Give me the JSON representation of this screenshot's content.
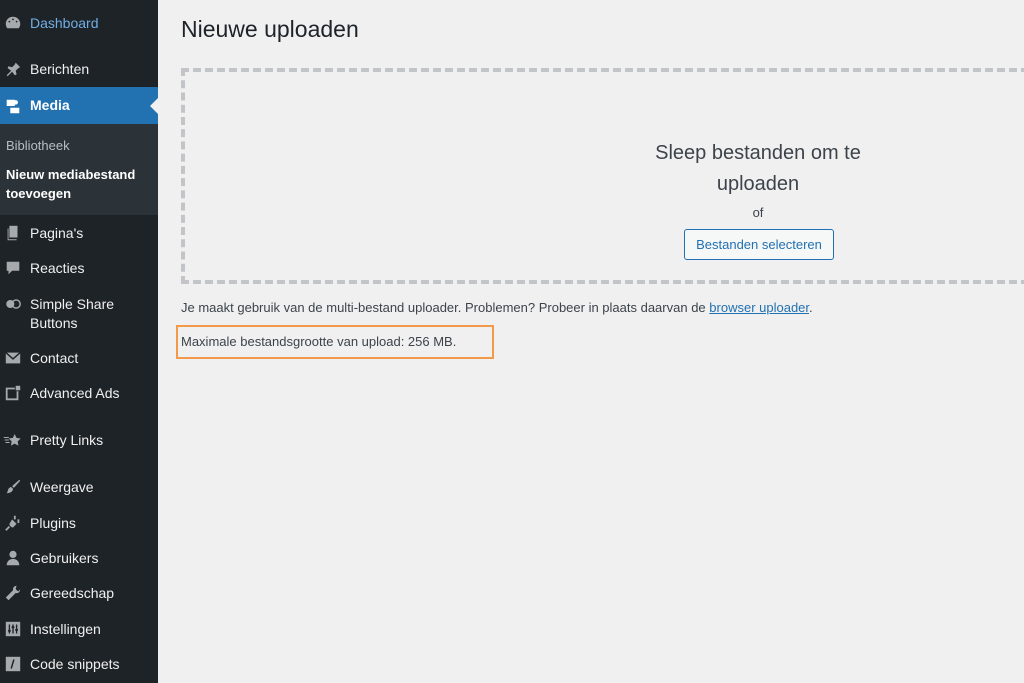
{
  "sidebar": {
    "items": [
      {
        "label": "Dashboard",
        "icon": "dashboard-icon"
      },
      {
        "label": "Berichten",
        "icon": "pin-icon"
      },
      {
        "label": "Media",
        "icon": "media-icon"
      },
      {
        "label": "Pagina's",
        "icon": "pages-icon"
      },
      {
        "label": "Reacties",
        "icon": "comment-icon"
      },
      {
        "label": "Simple Share Buttons",
        "icon": "share-icon"
      },
      {
        "label": "Contact",
        "icon": "mail-icon"
      },
      {
        "label": "Advanced Ads",
        "icon": "ads-icon"
      },
      {
        "label": "Pretty Links",
        "icon": "star-icon"
      },
      {
        "label": "Weergave",
        "icon": "brush-icon"
      },
      {
        "label": "Plugins",
        "icon": "plugin-icon"
      },
      {
        "label": "Gebruikers",
        "icon": "user-icon"
      },
      {
        "label": "Gereedschap",
        "icon": "wrench-icon"
      },
      {
        "label": "Instellingen",
        "icon": "settings-icon"
      },
      {
        "label": "Code snippets",
        "icon": "code-icon"
      }
    ],
    "submenu": [
      {
        "label": "Bibliotheek"
      },
      {
        "label": "Nieuw mediabestand toevoegen"
      }
    ],
    "accent": "#2271b1"
  },
  "main": {
    "title": "Nieuwe uploaden",
    "drop_instructions": "Sleep bestanden om te uploaden",
    "drop_or": "of",
    "select_button": "Bestanden selecteren",
    "multi_note": "Je maakt gebruik van de multi-bestand uploader. Problemen? Probeer in plaats daarvan de",
    "browser_uploader_link": "browser uploader",
    "note_end": ".",
    "max_size": "Maximale bestandsgrootte van upload: 256 MB.",
    "highlight_color": "#f29a4a"
  }
}
